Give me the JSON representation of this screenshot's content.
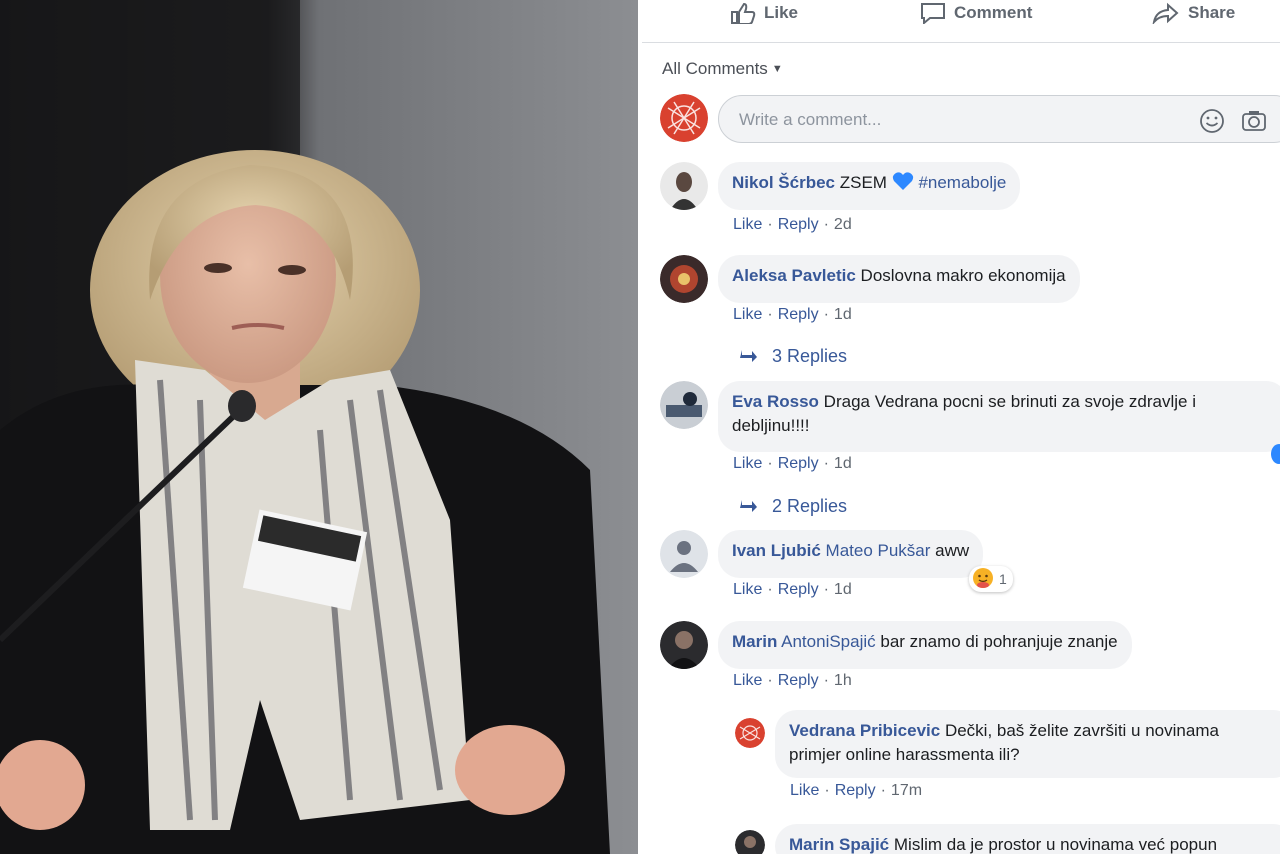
{
  "actions": {
    "like": "Like",
    "comment": "Comment",
    "share": "Share"
  },
  "filter": {
    "label": "All Comments"
  },
  "composer": {
    "placeholder": "Write a comment..."
  },
  "comments": [
    {
      "author": "Nikol Šćrbec",
      "text_before": "ZSEM",
      "hashtag": "#nemabolje",
      "meta": {
        "like": "Like",
        "reply": "Reply",
        "time": "2d"
      }
    },
    {
      "author": "Aleksa Pavletic",
      "text": "Doslovna makro ekonomija",
      "meta": {
        "like": "Like",
        "reply": "Reply",
        "time": "1d"
      },
      "replies": "3 Replies"
    },
    {
      "author": "Eva Rosso",
      "text_line1": "Draga Vedrana pocni se brinuti za svoje zdravlje i",
      "text_line2": "debljinu!!!!",
      "meta": {
        "like": "Like",
        "reply": "Reply",
        "time": "1d"
      },
      "replies": "2 Replies"
    },
    {
      "author": "Ivan Ljubić",
      "mention": "Mateo Pukšar",
      "text": "aww",
      "reaction_count": "1",
      "meta": {
        "like": "Like",
        "reply": "Reply",
        "time": "1d"
      }
    },
    {
      "author": "Marin",
      "mention": "AntoniSpajić",
      "text": "bar znamo di pohranjuje znanje",
      "meta": {
        "like": "Like",
        "reply": "Reply",
        "time": "1h"
      },
      "nested": [
        {
          "author": "Vedrana Pribicevic",
          "text_line1": "Dečki, baš želite završiti u novinama",
          "text_line2": "primjer online harassmenta ili?",
          "meta": {
            "like": "Like",
            "reply": "Reply",
            "time": "17m"
          }
        },
        {
          "author": "Marin Spajić",
          "text": "Mislim da je prostor u novinama već popun"
        }
      ]
    }
  ],
  "colors": {
    "link": "#385898",
    "meta": "#606770",
    "bubble": "#f2f3f5",
    "heart": "#2d88ff"
  }
}
